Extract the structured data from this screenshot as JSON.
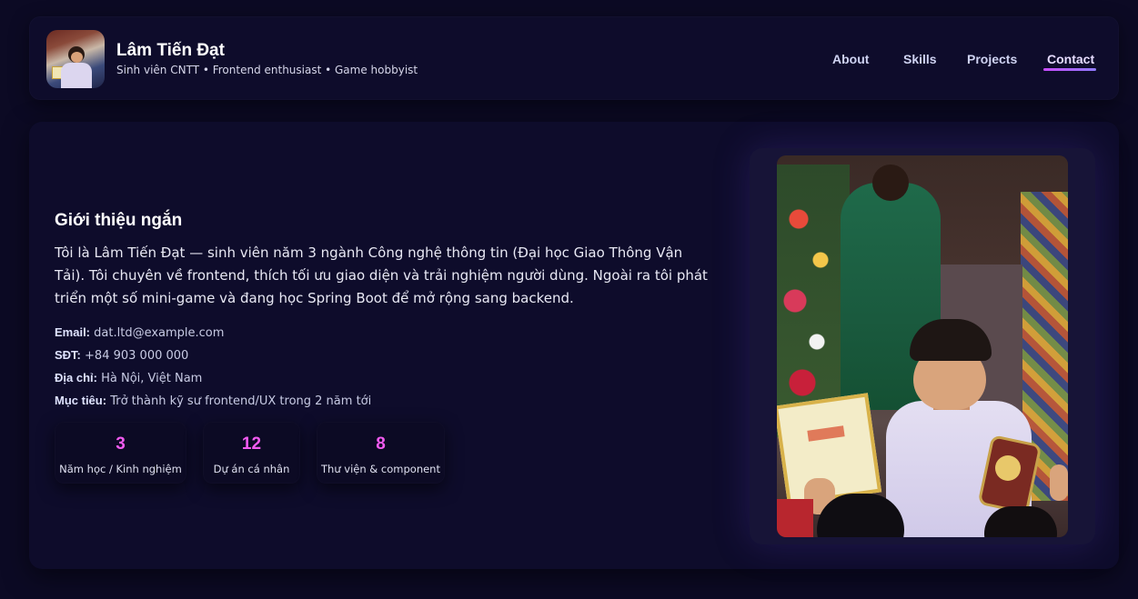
{
  "header": {
    "name": "Lâm Tiến Đạt",
    "tagline": "Sinh viên CNTT • Frontend enthusiast • Game hobbyist",
    "avatar_icon": "profile-avatar",
    "nav": [
      {
        "label": "About"
      },
      {
        "label": "Skills"
      },
      {
        "label": "Projects"
      },
      {
        "label": "Contact",
        "active": true
      }
    ]
  },
  "about": {
    "title": "Giới thiệu ngắn",
    "intro": "Tôi là Lâm Tiến Đạt — sinh viên năm 3 ngành Công nghệ thông tin (Đại học Giao Thông Vận Tải). Tôi chuyên về frontend, thích tối ưu giao diện và trải nghiệm người dùng. Ngoài ra tôi phát triển một số mini-game và đang học Spring Boot để mở rộng sang backend.",
    "details": [
      {
        "label": "Email:",
        "value": "dat.ltd@example.com"
      },
      {
        "label": "SĐT:",
        "value": "+84 903 000 000"
      },
      {
        "label": "Địa chỉ:",
        "value": "Hà Nội, Việt Nam"
      },
      {
        "label": "Mục tiêu:",
        "value": "Trở thành kỹ sư frontend/UX trong 2 năm tới"
      }
    ],
    "stats": [
      {
        "value": "3",
        "label": "Năm học / Kinh nghiệm"
      },
      {
        "value": "12",
        "label": "Dự án cá nhân"
      },
      {
        "value": "8",
        "label": "Thư viện & component"
      }
    ]
  },
  "colors": {
    "background": "#0c0a24",
    "card": "#0e0c2b",
    "accent": "#f25bf0",
    "nav_underline": "#b45cff"
  }
}
